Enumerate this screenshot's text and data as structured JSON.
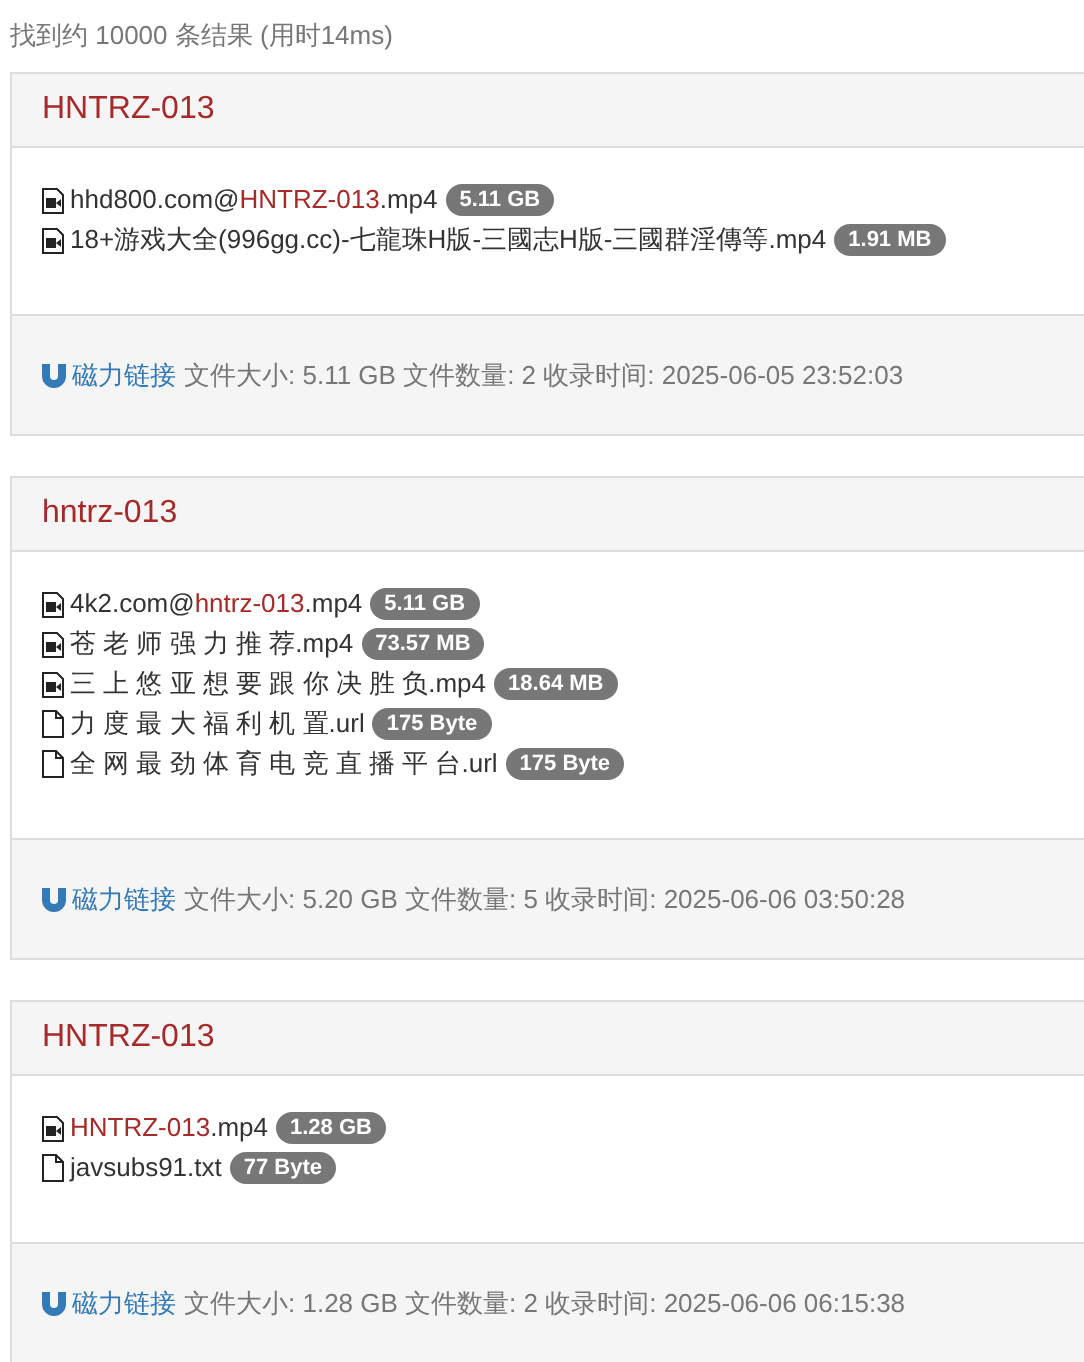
{
  "summary": "找到约 10000 条结果 (用时14ms)",
  "results": [
    {
      "title": "HNTRZ-013",
      "files": [
        {
          "kind": "video",
          "name_parts": [
            {
              "text": "hhd800.com@",
              "highlight": false
            },
            {
              "text": "HNTRZ-013",
              "highlight": true
            },
            {
              "text": ".mp4",
              "highlight": false
            }
          ],
          "size": "5.11 GB"
        },
        {
          "kind": "video",
          "name_parts": [
            {
              "text": "18+游戏大全(996gg.cc)-七龍珠H版-三國志H版-三國群淫傳等.mp4",
              "highlight": false
            }
          ],
          "size": "1.91 MB"
        }
      ],
      "magnet_link": "磁力链接",
      "info": "文件大小: 5.11 GB 文件数量: 2 收录时间: 2025-06-05 23:52:03"
    },
    {
      "title": "hntrz-013",
      "files": [
        {
          "kind": "video",
          "name_parts": [
            {
              "text": "4k2.com@",
              "highlight": false
            },
            {
              "text": "hntrz-013",
              "highlight": true
            },
            {
              "text": ".mp4",
              "highlight": false
            }
          ],
          "size": "5.11 GB"
        },
        {
          "kind": "video",
          "name_parts": [
            {
              "text": "苍 老 师 强 力 推 荐.mp4",
              "highlight": false
            }
          ],
          "size": "73.57 MB"
        },
        {
          "kind": "video",
          "name_parts": [
            {
              "text": "三 上 悠 亚 想 要 跟 你 决 胜 负.mp4",
              "highlight": false
            }
          ],
          "size": "18.64 MB"
        },
        {
          "kind": "document",
          "name_parts": [
            {
              "text": "力 度 最 大 福 利 机 置.url",
              "highlight": false
            }
          ],
          "size": "175 Byte"
        },
        {
          "kind": "document",
          "name_parts": [
            {
              "text": "全 网 最 劲 体 育 电 竞 直 播 平 台.url",
              "highlight": false
            }
          ],
          "size": "175 Byte"
        }
      ],
      "magnet_link": "磁力链接",
      "info": "文件大小: 5.20 GB 文件数量: 5 收录时间: 2025-06-06 03:50:28"
    },
    {
      "title": "HNTRZ-013",
      "files": [
        {
          "kind": "video",
          "name_parts": [
            {
              "text": "HNTRZ-013",
              "highlight": true
            },
            {
              "text": ".mp4",
              "highlight": false
            }
          ],
          "size": "1.28 GB"
        },
        {
          "kind": "document",
          "name_parts": [
            {
              "text": "javsubs91.txt",
              "highlight": false
            }
          ],
          "size": "77 Byte"
        }
      ],
      "magnet_link": "磁力链接",
      "info": "文件大小: 1.28 GB 文件数量: 2 收录时间: 2025-06-06 06:15:38"
    }
  ]
}
